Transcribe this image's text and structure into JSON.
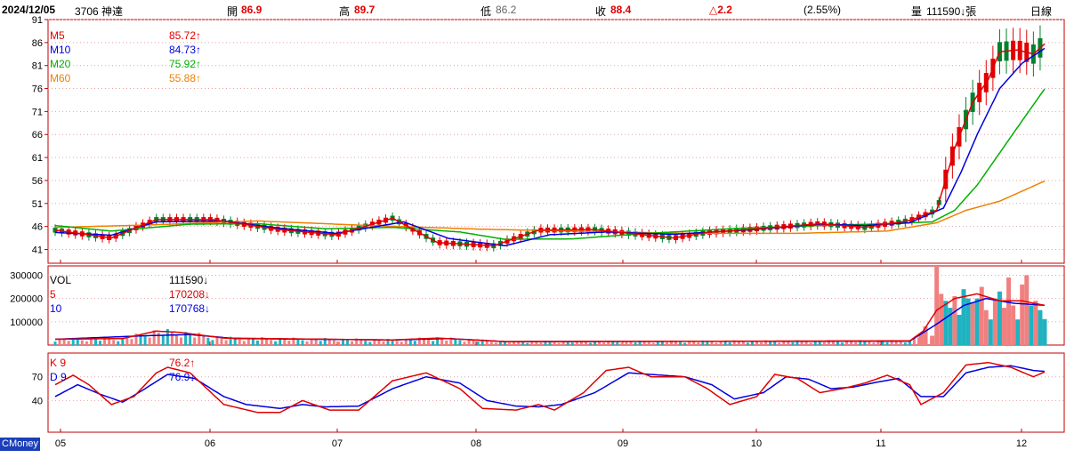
{
  "header": {
    "date": "2024/12/05",
    "stock": "3706 神達",
    "open_label": "開",
    "open": "86.9",
    "high_label": "高",
    "high": "89.7",
    "low_label": "低",
    "low": "86.2",
    "close_label": "收",
    "close": "88.4",
    "change": "△2.2",
    "change_pct": "(2.55%)",
    "vol_label": "量",
    "vol": "111590↓張",
    "period": "日線"
  },
  "branding": "CMoney",
  "colors": {
    "up": "#e00000",
    "down": "#00802b",
    "ma5": "#e00000",
    "ma10": "#0000e0",
    "ma20": "#00b000",
    "ma60": "#f08000",
    "vol_up": "#f08080",
    "vol_down": "#20b2c0",
    "k": "#e00000",
    "d": "#0000e0"
  },
  "chart_data": [
    {
      "type": "candlestick",
      "name": "price",
      "ylim": [
        38,
        91
      ],
      "yticks": [
        "91",
        "86",
        "81",
        "76",
        "71",
        "66",
        "61",
        "56",
        "51",
        "46",
        "41"
      ],
      "xticks": [
        "05",
        "06",
        "07",
        "08",
        "09",
        "10",
        "11",
        "12"
      ],
      "legend": [
        {
          "label": "M5",
          "value": "85.72↑"
        },
        {
          "label": "M10",
          "value": "84.73↑"
        },
        {
          "label": "M20",
          "value": "75.92↑"
        },
        {
          "label": "M60",
          "value": "55.88↑"
        }
      ],
      "ma_anchors": {
        "ma5": [
          [
            0,
            45.2
          ],
          [
            25,
            43.5
          ],
          [
            45,
            47.5
          ],
          [
            70,
            47.5
          ],
          [
            100,
            45.3
          ],
          [
            125,
            44.2
          ],
          [
            150,
            47.8
          ],
          [
            170,
            42.5
          ],
          [
            195,
            41.8
          ],
          [
            215,
            45.2
          ],
          [
            240,
            45.3
          ],
          [
            275,
            43.5
          ],
          [
            290,
            44.7
          ],
          [
            310,
            45.4
          ],
          [
            340,
            46.6
          ],
          [
            360,
            45.8
          ],
          [
            380,
            47.3
          ],
          [
            392,
            49.5
          ],
          [
            400,
            63
          ],
          [
            408,
            73
          ],
          [
            415,
            78
          ],
          [
            420,
            84
          ],
          [
            428,
            84.4
          ],
          [
            435,
            83.5
          ],
          [
            440,
            85.72
          ]
        ],
        "ma10": [
          [
            0,
            44.7
          ],
          [
            25,
            44.1
          ],
          [
            45,
            47
          ],
          [
            75,
            47.2
          ],
          [
            100,
            45.6
          ],
          [
            125,
            44.5
          ],
          [
            155,
            47
          ],
          [
            175,
            43.4
          ],
          [
            200,
            41.8
          ],
          [
            220,
            44.2
          ],
          [
            245,
            44.8
          ],
          [
            275,
            44.3
          ],
          [
            310,
            45.3
          ],
          [
            340,
            46.5
          ],
          [
            360,
            46.2
          ],
          [
            380,
            46.8
          ],
          [
            395,
            50
          ],
          [
            403,
            58
          ],
          [
            410,
            66
          ],
          [
            420,
            76
          ],
          [
            430,
            81.5
          ],
          [
            440,
            84.73
          ]
        ],
        "ma20": [
          [
            0,
            46.2
          ],
          [
            25,
            45
          ],
          [
            60,
            46.5
          ],
          [
            90,
            46.6
          ],
          [
            120,
            45.5
          ],
          [
            150,
            45.8
          ],
          [
            180,
            44.8
          ],
          [
            200,
            43.2
          ],
          [
            230,
            43.3
          ],
          [
            260,
            44.4
          ],
          [
            300,
            45.5
          ],
          [
            340,
            46.2
          ],
          [
            370,
            46.6
          ],
          [
            390,
            47
          ],
          [
            400,
            49.5
          ],
          [
            410,
            55
          ],
          [
            420,
            62
          ],
          [
            430,
            69
          ],
          [
            440,
            75.92
          ]
        ],
        "ma60": [
          [
            0,
            45.8
          ],
          [
            40,
            46.3
          ],
          [
            90,
            47.2
          ],
          [
            140,
            46.2
          ],
          [
            190,
            45.4
          ],
          [
            240,
            44.9
          ],
          [
            280,
            44.5
          ],
          [
            330,
            44.5
          ],
          [
            370,
            45
          ],
          [
            392,
            46.8
          ],
          [
            405,
            49.5
          ],
          [
            420,
            51.5
          ],
          [
            440,
            55.88
          ]
        ]
      }
    },
    {
      "type": "bar",
      "name": "volume",
      "ylim": [
        0,
        340000
      ],
      "yticks": [
        "300000",
        "200000",
        "100000"
      ],
      "legend": [
        {
          "label": "VOL",
          "value": "111590↓"
        },
        {
          "label": "5",
          "value": "170208↓"
        },
        {
          "label": "10",
          "value": "170768↓"
        }
      ],
      "bars": [
        [
          385,
          50000,
          1
        ],
        [
          387,
          80000,
          1
        ],
        [
          390,
          40000,
          1
        ],
        [
          392,
          340000,
          1
        ],
        [
          394,
          220000,
          1
        ],
        [
          396,
          190000,
          2
        ],
        [
          398,
          160000,
          2
        ],
        [
          400,
          210000,
          1
        ],
        [
          402,
          130000,
          2
        ],
        [
          404,
          240000,
          2
        ],
        [
          406,
          200000,
          2
        ],
        [
          408,
          180000,
          1
        ],
        [
          410,
          200000,
          2
        ],
        [
          412,
          250000,
          1
        ],
        [
          414,
          150000,
          1
        ],
        [
          416,
          110000,
          2
        ],
        [
          418,
          200000,
          1
        ],
        [
          420,
          230000,
          2
        ],
        [
          422,
          160000,
          1
        ],
        [
          424,
          290000,
          1
        ],
        [
          426,
          170000,
          1
        ],
        [
          428,
          110000,
          2
        ],
        [
          430,
          260000,
          1
        ],
        [
          432,
          300000,
          1
        ],
        [
          434,
          170000,
          2
        ],
        [
          436,
          190000,
          1
        ],
        [
          438,
          150000,
          2
        ],
        [
          440,
          111590,
          2
        ]
      ],
      "vol5": [
        [
          0,
          25000
        ],
        [
          30,
          28000
        ],
        [
          45,
          60000
        ],
        [
          55,
          55000
        ],
        [
          75,
          30000
        ],
        [
          150,
          22000
        ],
        [
          170,
          30000
        ],
        [
          200,
          15000
        ],
        [
          380,
          18000
        ],
        [
          386,
          60000
        ],
        [
          392,
          150000
        ],
        [
          400,
          200000
        ],
        [
          410,
          220000
        ],
        [
          420,
          190000
        ],
        [
          430,
          190000
        ],
        [
          440,
          170208
        ]
      ],
      "vol10": [
        [
          0,
          25000
        ],
        [
          40,
          40000
        ],
        [
          60,
          45000
        ],
        [
          80,
          28000
        ],
        [
          150,
          22000
        ],
        [
          175,
          28000
        ],
        [
          200,
          15000
        ],
        [
          380,
          17000
        ],
        [
          392,
          90000
        ],
        [
          404,
          170000
        ],
        [
          414,
          200000
        ],
        [
          426,
          180000
        ],
        [
          440,
          170768
        ]
      ]
    },
    {
      "type": "line",
      "name": "kd",
      "ylim": [
        0,
        100
      ],
      "yticks": [
        "70",
        "40"
      ],
      "legend": [
        {
          "label": "K 9",
          "value": "76.2↑"
        },
        {
          "label": "D 9",
          "value": "76.9↓"
        }
      ],
      "k": [
        [
          0,
          60
        ],
        [
          8,
          72
        ],
        [
          15,
          60
        ],
        [
          25,
          35
        ],
        [
          35,
          45
        ],
        [
          45,
          75
        ],
        [
          50,
          82
        ],
        [
          60,
          75
        ],
        [
          75,
          35
        ],
        [
          90,
          25
        ],
        [
          100,
          25
        ],
        [
          110,
          40
        ],
        [
          122,
          28
        ],
        [
          135,
          28
        ],
        [
          150,
          65
        ],
        [
          165,
          75
        ],
        [
          180,
          55
        ],
        [
          190,
          30
        ],
        [
          205,
          28
        ],
        [
          215,
          35
        ],
        [
          222,
          28
        ],
        [
          235,
          50
        ],
        [
          245,
          78
        ],
        [
          255,
          82
        ],
        [
          265,
          70
        ],
        [
          280,
          70
        ],
        [
          290,
          55
        ],
        [
          300,
          35
        ],
        [
          312,
          45
        ],
        [
          320,
          73
        ],
        [
          330,
          68
        ],
        [
          340,
          50
        ],
        [
          350,
          55
        ],
        [
          360,
          62
        ],
        [
          370,
          72
        ],
        [
          380,
          60
        ],
        [
          385,
          35
        ],
        [
          395,
          50
        ],
        [
          405,
          85
        ],
        [
          415,
          88
        ],
        [
          425,
          82
        ],
        [
          435,
          70
        ],
        [
          440,
          76.2
        ]
      ],
      "d": [
        [
          0,
          45
        ],
        [
          10,
          60
        ],
        [
          20,
          48
        ],
        [
          30,
          38
        ],
        [
          40,
          55
        ],
        [
          50,
          73
        ],
        [
          62,
          68
        ],
        [
          75,
          45
        ],
        [
          85,
          35
        ],
        [
          100,
          30
        ],
        [
          110,
          35
        ],
        [
          120,
          32
        ],
        [
          135,
          33
        ],
        [
          150,
          55
        ],
        [
          165,
          70
        ],
        [
          180,
          62
        ],
        [
          192,
          40
        ],
        [
          205,
          33
        ],
        [
          215,
          32
        ],
        [
          225,
          35
        ],
        [
          240,
          50
        ],
        [
          255,
          75
        ],
        [
          265,
          73
        ],
        [
          280,
          70
        ],
        [
          292,
          60
        ],
        [
          302,
          42
        ],
        [
          315,
          50
        ],
        [
          325,
          70
        ],
        [
          335,
          67
        ],
        [
          345,
          55
        ],
        [
          355,
          57
        ],
        [
          365,
          63
        ],
        [
          375,
          68
        ],
        [
          385,
          45
        ],
        [
          395,
          45
        ],
        [
          405,
          75
        ],
        [
          415,
          82
        ],
        [
          425,
          84
        ],
        [
          435,
          78
        ],
        [
          440,
          76.9
        ]
      ]
    }
  ]
}
